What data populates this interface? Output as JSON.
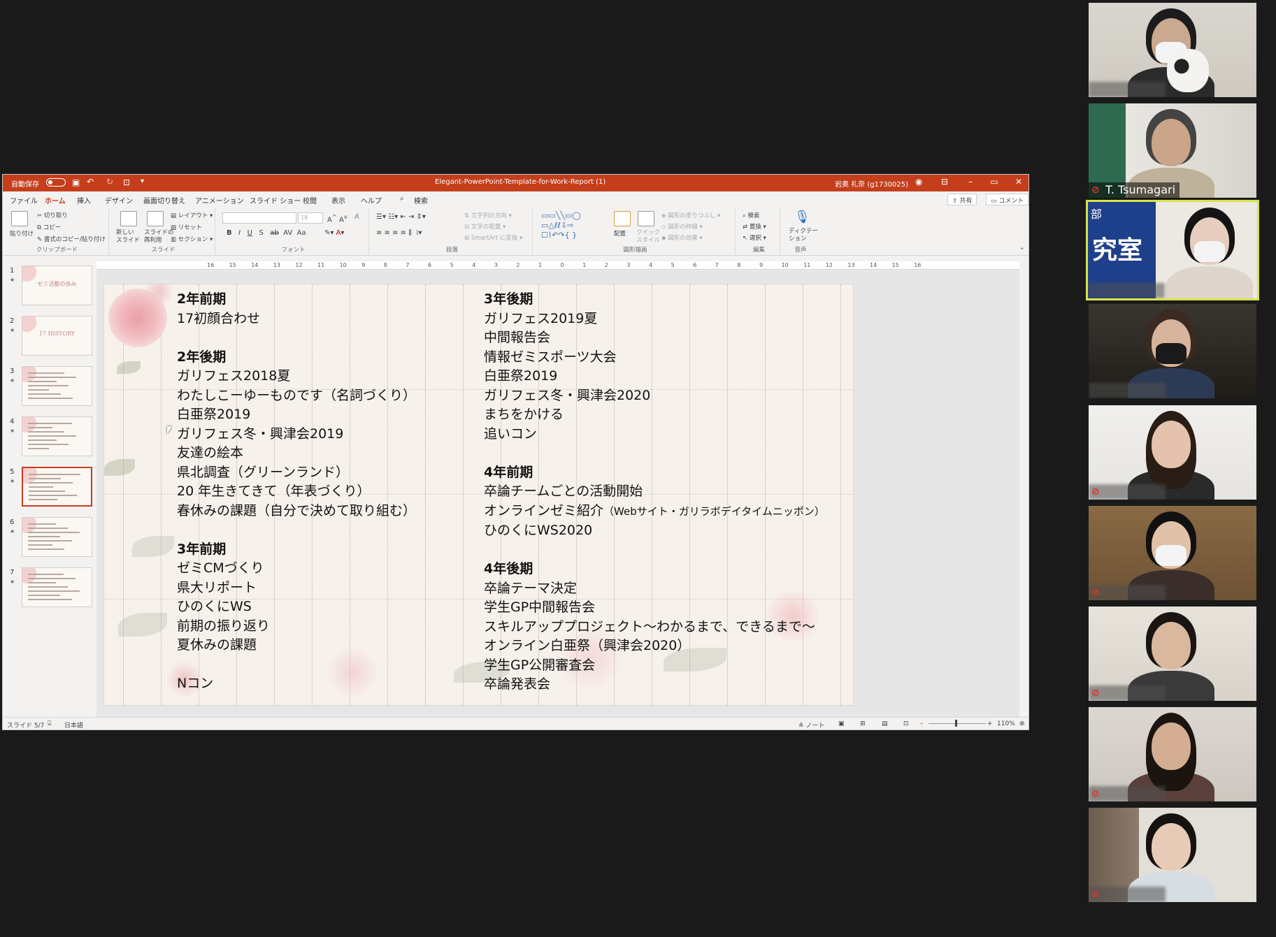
{
  "ppt": {
    "autosave_label": "自動保存",
    "autosave_state": "オフ",
    "window_title": "Elegant-PowerPoint-Template-for-Work-Report (1)",
    "user_name": "岩奥 礼奈 (g1730025)",
    "tabs": [
      "ファイル",
      "ホーム",
      "挿入",
      "デザイン",
      "画面切り替え",
      "アニメーション",
      "スライド ショー",
      "校閲",
      "表示",
      "ヘルプ"
    ],
    "active_tab": "ホーム",
    "search_label": "検索",
    "share_label": "共有",
    "comment_label": "コメント",
    "ribbon": {
      "clipboard": {
        "paste": "貼り付け",
        "cut": "切り取り",
        "copy": "コピー",
        "format_painter": "書式のコピー/貼り付け",
        "label": "クリップボード"
      },
      "slides": {
        "new_slide": "新しい\nスライド",
        "reuse": "スライドの\n再利用",
        "layout": "レイアウト",
        "reset": "リセット",
        "section": "セクション",
        "label": "スライド"
      },
      "font": {
        "label": "フォント",
        "size": "18"
      },
      "paragraph": {
        "text_direction": "文字列の方向",
        "align_text": "文字の配置",
        "smartart": "SmartArt に変換",
        "label": "段落"
      },
      "drawing": {
        "arrange": "配置",
        "quick_styles": "クイック\nスタイル",
        "fill": "図形の塗りつぶし",
        "outline": "図形の枠線",
        "effects": "図形の効果",
        "label": "図形描画"
      },
      "editing": {
        "find": "検索",
        "replace": "置換",
        "select": "選択",
        "label": "編集"
      },
      "voice": {
        "dictate": "ディクテー\nション",
        "label": "音声"
      }
    },
    "ruler_ticks": [
      "16",
      "15",
      "14",
      "13",
      "12",
      "11",
      "10",
      "9",
      "8",
      "7",
      "6",
      "5",
      "4",
      "3",
      "2",
      "1",
      "0",
      "1",
      "2",
      "3",
      "4",
      "5",
      "6",
      "7",
      "8",
      "9",
      "10",
      "11",
      "12",
      "13",
      "14",
      "15",
      "16"
    ],
    "thumbnails": [
      {
        "num": "1",
        "title": "ゼミ活動の歩み"
      },
      {
        "num": "2",
        "title": "17 HISTORY"
      },
      {
        "num": "3",
        "title": ""
      },
      {
        "num": "4",
        "title": ""
      },
      {
        "num": "5",
        "title": "",
        "active": true
      },
      {
        "num": "6",
        "title": ""
      },
      {
        "num": "7",
        "title": ""
      }
    ],
    "slide": {
      "left_col": [
        {
          "text": "2年前期",
          "bold": true
        },
        {
          "text": "17初顔合わせ"
        },
        {
          "text": ""
        },
        {
          "text": "2年後期",
          "bold": true
        },
        {
          "text": "ガリフェス2018夏"
        },
        {
          "text": "わたしこーゆーものです（名詞づくり）"
        },
        {
          "text": "白亜祭2019"
        },
        {
          "text": "ガリフェス冬・興津会2019"
        },
        {
          "text": "友達の絵本"
        },
        {
          "text": "県北調査（グリーンランド）"
        },
        {
          "text": "20 年生きてきて（年表づくり）"
        },
        {
          "text": "春休みの課題（自分で決めて取り組む）"
        },
        {
          "text": ""
        },
        {
          "text": "3年前期",
          "bold": true
        },
        {
          "text": "ゼミCMづくり"
        },
        {
          "text": "県大リポート"
        },
        {
          "text": "ひのくにWS"
        },
        {
          "text": "前期の振り返り"
        },
        {
          "text": "夏休みの課題"
        },
        {
          "text": ""
        },
        {
          "text": "Nコン"
        }
      ],
      "right_col": [
        {
          "text": "3年後期",
          "bold": true
        },
        {
          "text": "ガリフェス2019夏"
        },
        {
          "text": "中間報告会"
        },
        {
          "text": "情報ゼミスポーツ大会"
        },
        {
          "text": "白亜祭2019"
        },
        {
          "text": "ガリフェス冬・興津会2020"
        },
        {
          "text": "まちをかける"
        },
        {
          "text": "追いコン"
        },
        {
          "text": ""
        },
        {
          "text": "4年前期",
          "bold": true
        },
        {
          "text": "卒論チームごとの活動開始"
        },
        {
          "text": "オンラインゼミ紹介",
          "suffix": "（Webサイト・ガリラボデイタイムニッポン）"
        },
        {
          "text": "ひのくにWS2020"
        },
        {
          "text": ""
        },
        {
          "text": "4年後期",
          "bold": true
        },
        {
          "text": "卒論テーマ決定"
        },
        {
          "text": "学生GP中間報告会"
        },
        {
          "text": "スキルアッププロジェクト～わかるまで、できるまで～"
        },
        {
          "text": "オンライン白亜祭（興津会2020）"
        },
        {
          "text": "学生GP公開審査会"
        },
        {
          "text": "卒論発表会"
        }
      ]
    },
    "status": {
      "slide_counter": "スライド 5/7",
      "language": "日本語",
      "notes": "ノート",
      "zoom": "110%"
    }
  },
  "participants": [
    {
      "name": "",
      "muted": false,
      "active": false,
      "scene": "cap-cow"
    },
    {
      "name": "T. Tsumagari",
      "muted": true,
      "active": false,
      "scene": "elder-office"
    },
    {
      "name": "",
      "muted": false,
      "active": true,
      "scene": "lab-sign",
      "sign_text": "究室",
      "sign_corner": "部"
    },
    {
      "name": "",
      "muted": false,
      "active": false,
      "scene": "car"
    },
    {
      "name": "",
      "muted": true,
      "active": false,
      "scene": "room-white"
    },
    {
      "name": "",
      "muted": true,
      "active": false,
      "scene": "room-wood"
    },
    {
      "name": "",
      "muted": true,
      "active": false,
      "scene": "room-light"
    },
    {
      "name": "",
      "muted": true,
      "active": false,
      "scene": "room-plain"
    },
    {
      "name": "",
      "muted": true,
      "active": false,
      "scene": "room-shelf"
    }
  ],
  "colors": {
    "ppt_accent": "#c43e1c",
    "active_speaker": "#d7e34a",
    "mute_red": "#e0322f",
    "meeting_bg": "#1a1a1a"
  }
}
